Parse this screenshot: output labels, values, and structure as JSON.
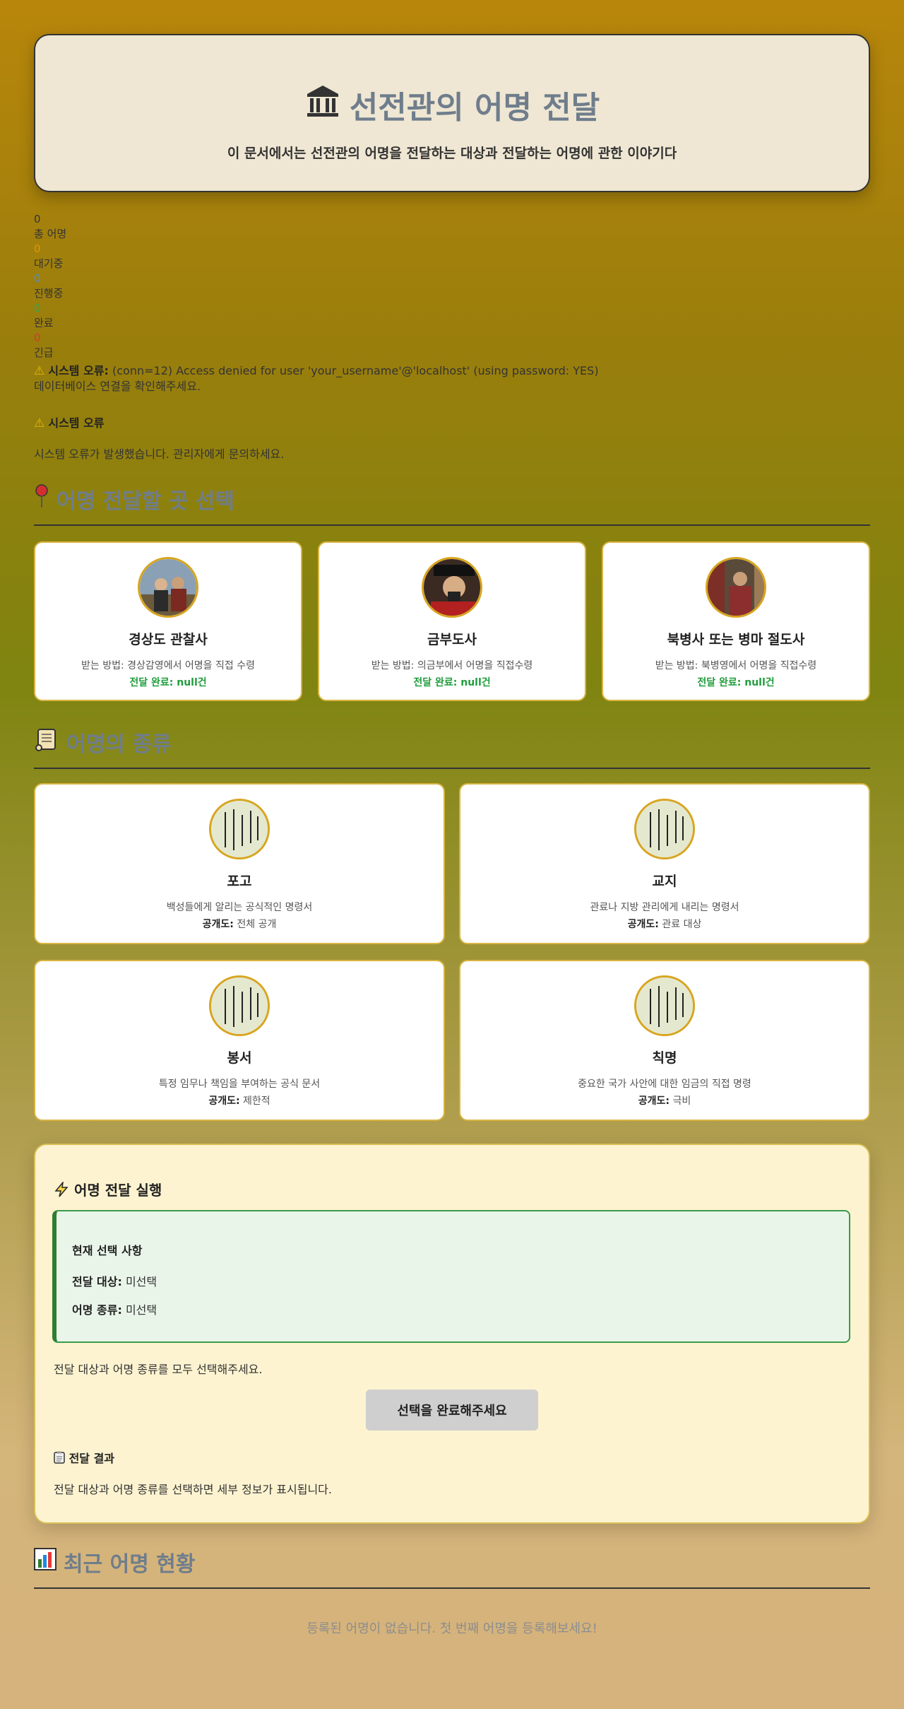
{
  "header": {
    "title": "선전관의 어명 전달",
    "subtitle": "이 문서에서는 선전관의 어명을 전달하는 대상과 전달하는 어명에 관한 이야기다",
    "icon": "temple-icon"
  },
  "stats": {
    "total_value": "0",
    "total_label": "총 어명",
    "waiting_value": "0",
    "waiting_label": "대기중",
    "progress_value": "0",
    "progress_label": "진행중",
    "done_value": "0",
    "done_label": "완료",
    "urgent_value": "0",
    "urgent_label": "긴급"
  },
  "errors": {
    "db_label": "시스템 오류:",
    "db_message": "(conn=12) Access denied for user 'your_username'@'localhost' (using password: YES)",
    "db_hint": "데이터베이스 연결을 확인해주세요.",
    "sys_label": "시스템 오류",
    "sys_message": "시스템 오류가 발생했습니다. 관리자에게 문의하세요."
  },
  "targets": {
    "section_title": "어명 전달할 곳 선택",
    "items": [
      {
        "name": "경상도 관찰사",
        "desc": "받는 방법: 경상감영에서 어명을 직접 수령",
        "done": "전달 완료: null건"
      },
      {
        "name": "금부도사",
        "desc": "받는 방법: 의금부에서 어명을 직접수령",
        "done": "전달 완료: null건"
      },
      {
        "name": "북병사 또는 병마 절도사",
        "desc": "받는 방법: 북병영에서 어명을 직접수령",
        "done": "전달 완료: null건"
      }
    ]
  },
  "types": {
    "section_title": "어명의 종류",
    "open_label": "공개도:",
    "items": [
      {
        "name": "포고",
        "desc": "백성들에게 알리는 공식적인 명령서",
        "open": "전체 공개"
      },
      {
        "name": "교지",
        "desc": "관료나 지방 관리에게 내리는 명령서",
        "open": "관료 대상"
      },
      {
        "name": "봉서",
        "desc": "특정 임무나 책임을 부여하는 공식 문서",
        "open": "제한적"
      },
      {
        "name": "칙명",
        "desc": "중요한 국가 사안에 대한 임금의 직접 명령",
        "open": "극비"
      }
    ]
  },
  "exec": {
    "title": "어명 전달 실행",
    "current_title": "현재 선택 사항",
    "target_label": "전달 대상:",
    "target_value": "미선택",
    "type_label": "어명 종류:",
    "type_value": "미선택",
    "message": "전달 대상과 어명 종류를 모두 선택해주세요.",
    "button_label": "선택을 완료해주세요",
    "result_title": "전달 결과",
    "result_text": "전달 대상과 어명 종류를 선택하면 세부 정보가 표시됩니다."
  },
  "recent": {
    "section_title": "최근 어명 현황",
    "empty_text": "등록된 어명이 없습니다. 첫 번째 어명을 등록해보세요!"
  }
}
